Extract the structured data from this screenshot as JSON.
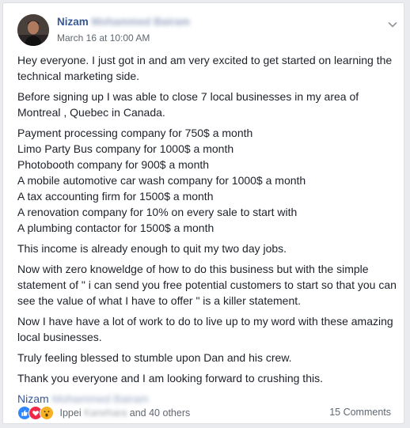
{
  "post": {
    "author_first": "Nizam",
    "author_rest_obscured": "Mohammed Bairam",
    "timestamp": "March 16 at 10:00 AM",
    "paragraphs": [
      {
        "lines": [
          "Hey everyone. I just got in and am very excited to get started on learning the technical marketing side."
        ]
      },
      {
        "lines": [
          "Before signing up I was able to close 7 local businesses in my area of Montreal , Quebec in Canada."
        ]
      },
      {
        "lines": [
          "Payment processing company for 750$ a month",
          "Limo Party Bus company for 1000$ a month",
          "Photobooth company for 900$ a month",
          "A mobile automotive car wash company for 1000$ a month",
          "A tax accounting firm for 1500$ a month",
          "A renovation company for 10% on every sale to start with",
          "A plumbing contactor for 1500$ a month"
        ]
      },
      {
        "lines": [
          "This income is already enough to quit my two day jobs."
        ]
      },
      {
        "lines": [
          "Now with zero knoweldge of how to do this business but with the simple statement of \" i can send you free potential customers to start so that you can see the value of what I have to offer \" is a killer statement."
        ]
      },
      {
        "lines": [
          "Now I have have a lot of work to do to live up to my word with these amazing local businesses."
        ]
      },
      {
        "lines": [
          "Truly feeling blessed to stumble upon Dan and his crew."
        ]
      },
      {
        "lines": [
          "Thank you everyone and I am looking forward to crushing this."
        ]
      }
    ],
    "signature_first": "Nizam",
    "signature_rest_obscured": "Mohammed Bairam"
  },
  "footer": {
    "reaction_icons": [
      "like-icon",
      "love-icon",
      "wow-icon"
    ],
    "reactor_first": "Ippei",
    "reactor_obscured": "Kanehara",
    "reactor_suffix": "and 40 others",
    "comments_label": "15 Comments"
  },
  "colors": {
    "link_blue": "#365899",
    "like": "#2d88ff",
    "love": "#f0284a",
    "wow": "#f7b125",
    "text": "#1d2129",
    "meta": "#616770"
  }
}
